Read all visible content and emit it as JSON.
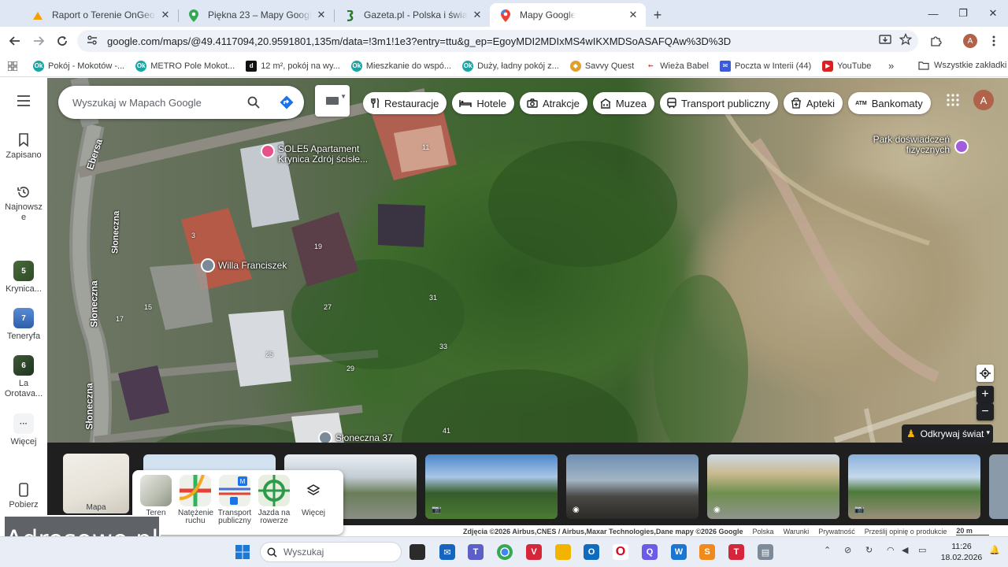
{
  "browser": {
    "tabs": [
      {
        "title": "Raport o Terenie OnGeo.pl – An",
        "icon": "ongeo-icon",
        "active": false
      },
      {
        "title": "Piękna 23 – Mapy Google",
        "icon": "maps-pin-icon",
        "active": false
      },
      {
        "title": "Gazeta.pl - Polska i świat - wiad",
        "icon": "gazeta-icon",
        "active": false
      },
      {
        "title": "Mapy Google",
        "icon": "maps-pin-icon",
        "active": true
      }
    ],
    "new_tab": "+",
    "url": "google.com/maps/@49.4117094,20.9591801,135m/data=!3m1!1e3?entry=ttu&g_ep=EgoyMDI2MDIxMS4wIKXMDSoASAFQAw%3D%3D",
    "profile_initial": "A",
    "bookmarks": [
      {
        "label": "Pokój - Mokotów -...",
        "color": "#1aa5a5"
      },
      {
        "label": "METRO Pole Mokot...",
        "color": "#1aa5a5"
      },
      {
        "label": "12 m², pokój na wy...",
        "color": "#111111"
      },
      {
        "label": "Mieszkanie do wspó...",
        "color": "#1aa5a5"
      },
      {
        "label": "Duży, ładny pokój z...",
        "color": "#1aa5a5"
      },
      {
        "label": "Savvy Quest",
        "color": "#e0a030"
      },
      {
        "label": "Wieża Babel",
        "color": "#d04040"
      },
      {
        "label": "Poczta w Interii (44)",
        "color": "#3b5bdb"
      },
      {
        "label": "YouTube",
        "color": "#e02020"
      }
    ],
    "all_bookmarks": "Wszystkie zakładki"
  },
  "rail": {
    "saved": "Zapisano",
    "recent": "Najnowsze",
    "recent_items": [
      {
        "label": "Krynica...",
        "badge": "5"
      },
      {
        "label": "Teneryfa",
        "badge": "7"
      },
      {
        "label": "La Orotava...",
        "badge": "6"
      }
    ],
    "more": "Więcej",
    "download": "Pobierz"
  },
  "search": {
    "placeholder": "Wyszukaj w Mapach Google"
  },
  "chips": [
    {
      "label": "Restauracje",
      "icon": "fork-knife-icon"
    },
    {
      "label": "Hotele",
      "icon": "bed-icon"
    },
    {
      "label": "Atrakcje",
      "icon": "camera-icon"
    },
    {
      "label": "Muzea",
      "icon": "museum-icon"
    },
    {
      "label": "Transport publiczny",
      "icon": "train-icon"
    },
    {
      "label": "Apteki",
      "icon": "pharmacy-icon"
    },
    {
      "label": "Bankomaty",
      "icon": "atm-icon"
    }
  ],
  "map": {
    "streets": [
      "Ebersa",
      "Słoneczna",
      "Słoneczna",
      "Słoneczna"
    ],
    "pois": [
      {
        "label": "SOLE5 Apartament Krynica Zdrój ścisłe...",
        "color": "#e8508a"
      },
      {
        "label": "Willa Franciszek",
        "color": "#7a8a99"
      },
      {
        "label": "Park doświadczeń fizycznych",
        "color": "#a25ddc"
      },
      {
        "label": "Słoneczna 37",
        "color": "#7a8a99"
      }
    ],
    "house_numbers": [
      "11",
      "3",
      "19",
      "15",
      "17",
      "27",
      "31",
      "33",
      "25",
      "29",
      "41"
    ],
    "user_initial": "A",
    "explore_label": "Odkrywaj świat"
  },
  "layers": {
    "map_label": "Mapa",
    "items": [
      {
        "label": "Teren"
      },
      {
        "label": "Natężenie ruchu"
      },
      {
        "label": "Transport publiczny"
      },
      {
        "label": "Jazda na rowerze"
      },
      {
        "label": "Więcej"
      }
    ]
  },
  "attribution": {
    "imagery": "Zdjęcia ©2026 Airbus,CNES / Airbus,Maxar Technologies,Dane mapy ©2026 Google",
    "country": "Polska",
    "terms": "Warunki",
    "privacy": "Prywatność",
    "feedback": "Prześlij opinię o produkcie",
    "scale": "20 m"
  },
  "watermark": "Adresowo.pl",
  "taskbar": {
    "search_placeholder": "Wyszukaj",
    "time": "11:26",
    "date": "18.02.2026"
  }
}
